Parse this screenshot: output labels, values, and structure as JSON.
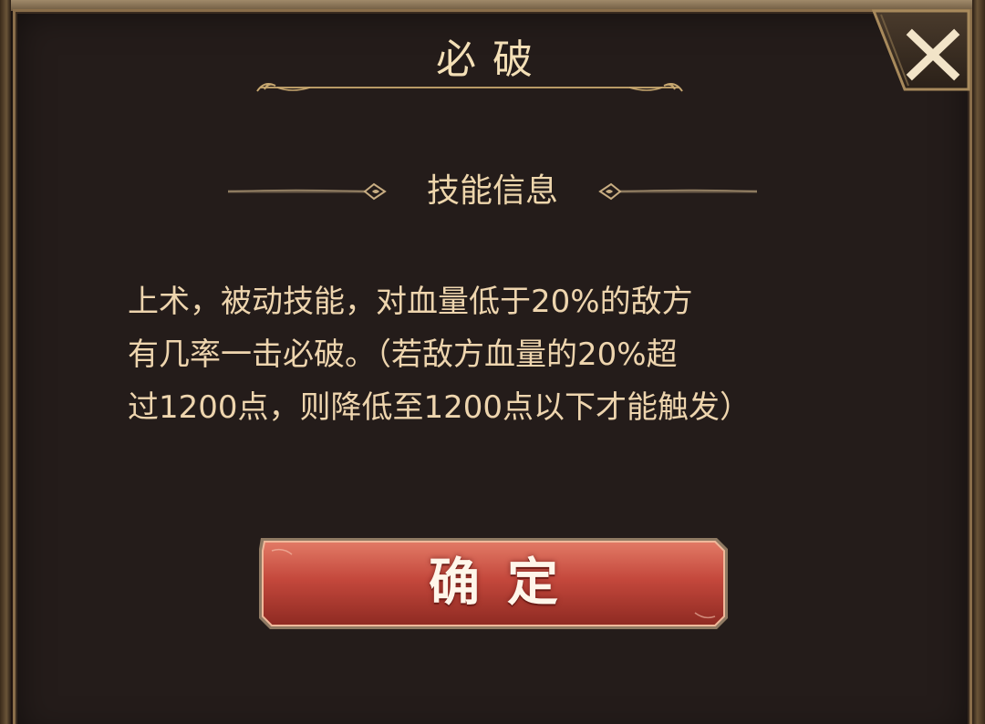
{
  "dialog": {
    "title": "必破",
    "close_icon": "close-icon"
  },
  "section": {
    "title": "技能信息"
  },
  "description": {
    "lines": [
      "上术，被动技能，对血量低于20%的敌方",
      "有几率一击必破。（若敌方血量的20%超",
      "过1200点，则降低至1200点以下才能触发）"
    ]
  },
  "actions": {
    "confirm_label": "确定"
  },
  "colors": {
    "panel": "#241c1a",
    "gold_text": "#eed6ac",
    "border": "#8a6e4a",
    "button_red": "#c0453a"
  }
}
